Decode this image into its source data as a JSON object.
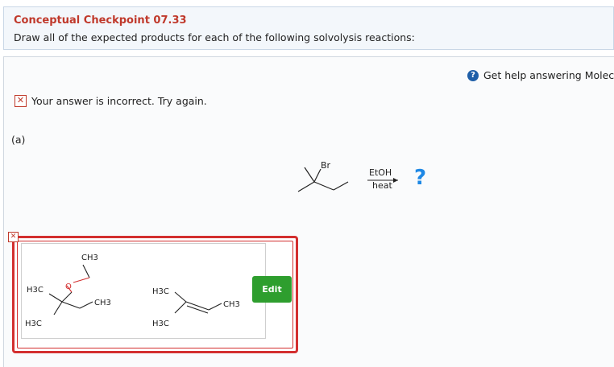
{
  "header": {
    "title": "Conceptual Checkpoint 07.33",
    "instruction": "Draw all of the expected products for each of the following solvolysis reactions:"
  },
  "help": {
    "label": "Get help answering Molecu"
  },
  "feedback": {
    "message": "Your answer is incorrect.  Try again."
  },
  "part": {
    "label": "(a)"
  },
  "reaction": {
    "substituent": "Br",
    "reagent": "EtOH",
    "condition": "heat",
    "product": "?"
  },
  "answer": {
    "molecule1": {
      "ch3_top": "CH3",
      "h3c_left": "H3C",
      "oxygen": "O",
      "ch3_right": "CH3",
      "h3c_bottom": "H3C"
    },
    "molecule2": {
      "h3c_top": "H3C",
      "ch3_right": "CH3",
      "h3c_bottom": "H3C"
    },
    "edit_label": "Edit"
  },
  "colors": {
    "title_red": "#c0392b",
    "edit_green": "#2e9e2e",
    "help_blue": "#1f5fa8",
    "ether_oxygen": "#d32f2f",
    "question_blue": "#1e88e5"
  }
}
